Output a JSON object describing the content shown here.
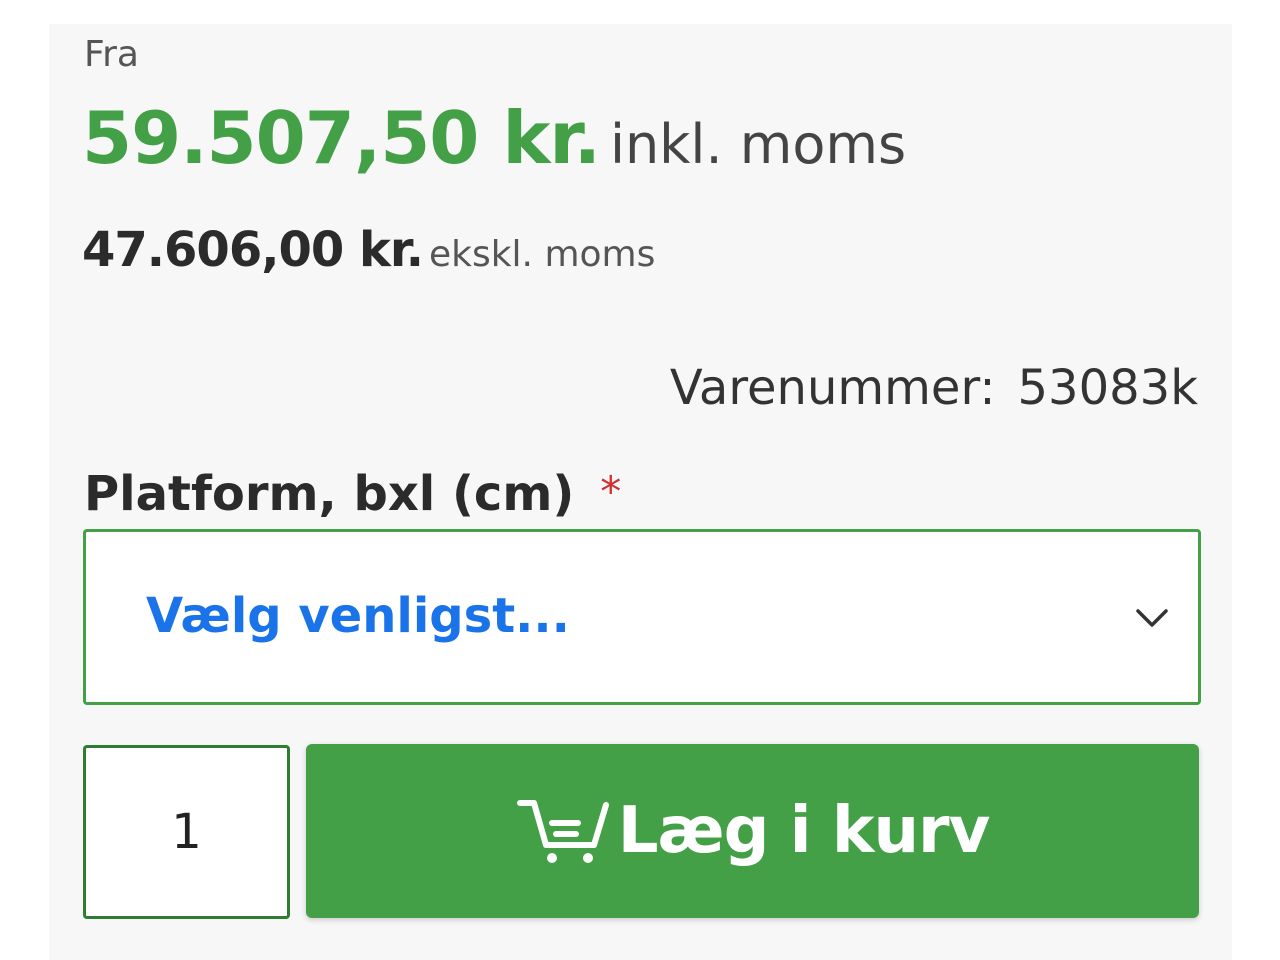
{
  "price": {
    "from_label": "Fra",
    "incl_value": "59.507,50 kr.",
    "incl_suffix": "inkl. moms",
    "excl_value": "47.606,00 kr.",
    "excl_suffix": "ekskl. moms"
  },
  "sku": {
    "label": "Varenummer:",
    "value": "53083k"
  },
  "option": {
    "label": "Platform, bxl (cm)",
    "required_mark": "*",
    "selected_text": "Vælg venligst..."
  },
  "purchase": {
    "quantity": "1",
    "add_to_cart_label": "Læg i kurv"
  },
  "icons": {
    "cart": "cart-icon",
    "chevron": "chevron-down-icon"
  },
  "colors": {
    "accent_green": "#43a047",
    "link_blue": "#1a73e8",
    "required_red": "#d32f2f"
  }
}
